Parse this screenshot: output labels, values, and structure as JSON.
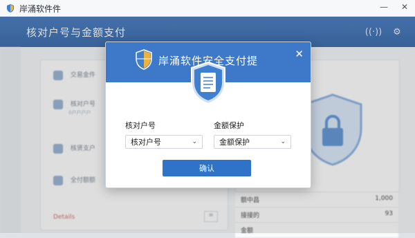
{
  "window": {
    "title": "岸涌软件件"
  },
  "header": {
    "title": "核对户号与金额支付"
  },
  "background": {
    "panel_items": [
      "交易金件",
      "核对户号",
      "核贤支户",
      "全付额额"
    ],
    "panel_sub_items": [
      "",
      "0户户户户",
      "",
      ""
    ],
    "red_link": "Details",
    "stats": [
      {
        "label": "额中昌",
        "value": "1,000"
      },
      {
        "label": "接接的",
        "value": "93"
      },
      {
        "label": "金额",
        "value": ""
      }
    ]
  },
  "dialog": {
    "title": "岸涌软件安全支付提",
    "close_label": "✕",
    "field1": {
      "label": "核对户号",
      "value": "核对户号"
    },
    "field2": {
      "label": "金额保护",
      "value": "金额保护"
    },
    "confirm_label": "确认"
  },
  "colors": {
    "header": "#3e79c9",
    "button": "#2f73c9",
    "shield_blue": "#3f7fd0",
    "shield_gold": "#f1b23a"
  }
}
